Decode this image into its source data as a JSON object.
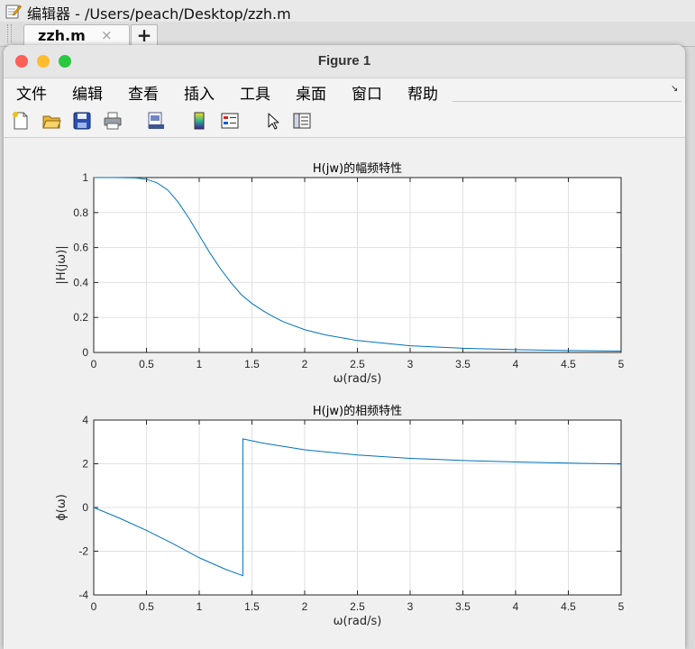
{
  "editor": {
    "title": "编辑器 - /Users/peach/Desktop/zzh.m",
    "tab_label": "zzh.m",
    "tab_close": "×",
    "new_tab": "+"
  },
  "figure_window": {
    "title": "Figure 1",
    "menu": [
      "文件",
      "编辑",
      "查看",
      "插入",
      "工具",
      "桌面",
      "窗口",
      "帮助"
    ],
    "menu_corner": "↘",
    "toolbar": [
      "new-figure-icon",
      "open-file-icon",
      "save-icon",
      "print-icon",
      "print-preview-icon",
      "colorbar-icon",
      "legend-icon",
      "pointer-icon",
      "property-editor-icon"
    ]
  },
  "colors": {
    "line": "#0072bd",
    "grid": "#e1e1e1",
    "close": "#fe5f57",
    "minimize": "#febc2e",
    "zoom": "#28c840"
  },
  "chart_data": [
    {
      "type": "line",
      "title": "H(jw)的幅频特性",
      "xlabel": "ω(rad/s)",
      "ylabel": "|H(jω)|",
      "xlim": [
        0,
        5
      ],
      "ylim": [
        0,
        1
      ],
      "xticks": [
        "0",
        "0.5",
        "1",
        "1.5",
        "2",
        "2.5",
        "3",
        "3.5",
        "4",
        "4.5",
        "5"
      ],
      "yticks": [
        "0",
        "0.2",
        "0.4",
        "0.6",
        "0.8",
        "1"
      ],
      "grid": true,
      "series": [
        {
          "x": [
            0,
            0.2,
            0.4,
            0.5,
            0.6,
            0.7,
            0.8,
            0.9,
            1.0,
            1.1,
            1.2,
            1.3,
            1.4,
            1.5,
            1.6,
            1.7,
            1.8,
            2.0,
            2.2,
            2.5,
            3.0,
            3.5,
            4.0,
            4.5,
            5.0
          ],
          "y": [
            1.0,
            1.0,
            0.998,
            0.99,
            0.97,
            0.93,
            0.86,
            0.77,
            0.67,
            0.57,
            0.48,
            0.4,
            0.33,
            0.28,
            0.24,
            0.205,
            0.175,
            0.13,
            0.1,
            0.068,
            0.038,
            0.024,
            0.016,
            0.011,
            0.008
          ]
        }
      ]
    },
    {
      "type": "line",
      "title": "H(jw)的相频特性",
      "xlabel": "ω(rad/s)",
      "ylabel": "ϕ(ω)",
      "xlim": [
        0,
        5
      ],
      "ylim": [
        -4,
        4
      ],
      "xticks": [
        "0",
        "0.5",
        "1",
        "1.5",
        "2",
        "2.5",
        "3",
        "3.5",
        "4",
        "4.5",
        "5"
      ],
      "yticks": [
        "-4",
        "-2",
        "0",
        "2",
        "4"
      ],
      "grid": true,
      "series": [
        {
          "x": [
            0,
            0.25,
            0.5,
            0.75,
            1.0,
            1.25,
            1.414,
            1.414,
            1.6,
            2.0,
            2.5,
            3.0,
            3.5,
            4.0,
            4.5,
            5.0
          ],
          "y": [
            0,
            -0.5,
            -1.05,
            -1.65,
            -2.3,
            -2.83,
            -3.12,
            3.14,
            2.95,
            2.64,
            2.4,
            2.25,
            2.15,
            2.08,
            2.03,
            1.99
          ]
        }
      ]
    }
  ]
}
